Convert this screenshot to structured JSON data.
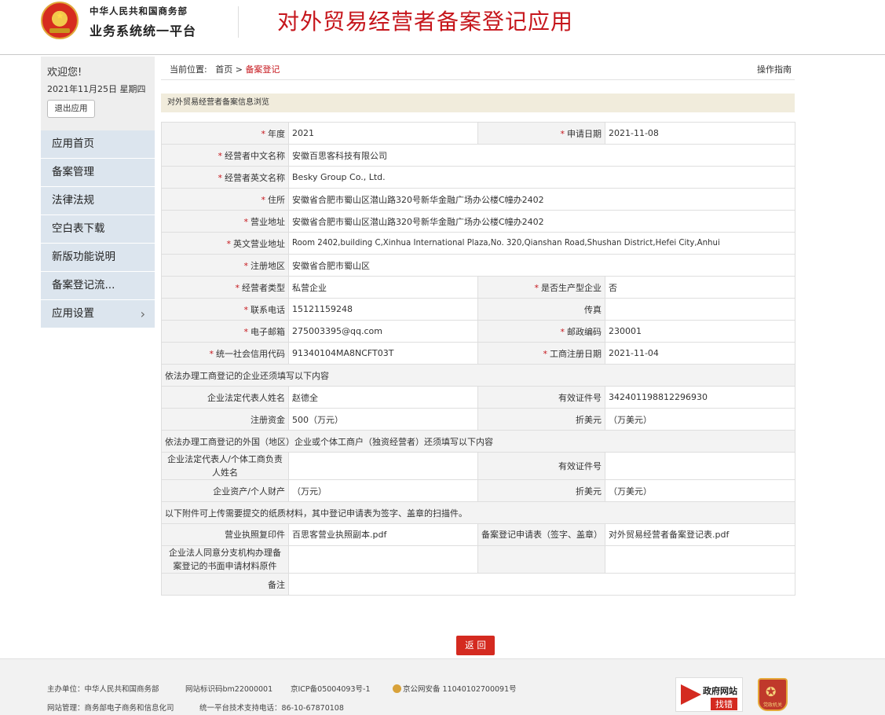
{
  "header": {
    "org_line1": "中华人民共和国商务部",
    "org_line2": "业务系统统一平台",
    "app_title": "对外贸易经营者备案登记应用"
  },
  "sidebar": {
    "welcome": "欢迎您!",
    "date": "2021年11月25日 星期四",
    "logout_label": "退出应用",
    "items": [
      {
        "label": "应用首页"
      },
      {
        "label": "备案管理"
      },
      {
        "label": "法律法规"
      },
      {
        "label": "空白表下载"
      },
      {
        "label": "新版功能说明"
      },
      {
        "label": "备案登记流..."
      },
      {
        "label": "应用设置",
        "icon": "chevron-right-icon"
      }
    ]
  },
  "breadcrumb": {
    "prefix": "当前位置:",
    "home": "首页",
    "sep": ">",
    "current": "备案登记"
  },
  "guide_link": "操作指南",
  "section_title": "对外贸易经营者备案信息浏览",
  "form": {
    "year_label": "年度",
    "year": "2021",
    "apply_date_label": "申请日期",
    "apply_date": "2021-11-08",
    "cn_name_label": "经营者中文名称",
    "cn_name": "安徽百思客科技有限公司",
    "en_name_label": "经营者英文名称",
    "en_name": "Besky Group Co., Ltd.",
    "residence_label": "住所",
    "residence": "安徽省合肥市蜀山区潜山路320号新华金融广场办公楼C幢办2402",
    "biz_addr_label": "营业地址",
    "biz_addr": "安徽省合肥市蜀山区潜山路320号新华金融广场办公楼C幢办2402",
    "en_biz_addr_label": "英文营业地址",
    "en_biz_addr": "Room 2402,building C,Xinhua International Plaza,No. 320,Qianshan Road,Shushan District,Hefei City,Anhui",
    "reg_area_label": "注册地区",
    "reg_area": "安徽省合肥市蜀山区",
    "type_label": "经营者类型",
    "type": "私营企业",
    "producer_label": "是否生产型企业",
    "producer": "否",
    "phone_label": "联系电话",
    "phone": "15121159248",
    "fax_label": "传真",
    "fax": "",
    "email_label": "电子邮箱",
    "email": "275003395@qq.com",
    "postcode_label": "邮政编码",
    "postcode": "230001",
    "credit_code_label": "统一社会信用代码",
    "credit_code": "91340104MA8NCFT03T",
    "biz_reg_date_label": "工商注册日期",
    "biz_reg_date": "2021-11-04",
    "sec1": "依法办理工商登记的企业还须填写以下内容",
    "legal_rep_label": "企业法定代表人姓名",
    "legal_rep": "赵德全",
    "id_no_label": "有效证件号",
    "id_no": "342401198812296930",
    "capital_label": "注册资金",
    "capital": "500（万元）",
    "usd_label": "折美元",
    "usd": "（万美元）",
    "sec2": "依法办理工商登记的外国（地区）企业或个体工商户（独资经营者）还须填写以下内容",
    "foreign_rep_label": "企业法定代表人/个体工商负责人姓名",
    "foreign_rep": "",
    "foreign_id_label": "有效证件号",
    "foreign_id": "",
    "assets_label": "企业资产/个人财产",
    "assets": "（万元）",
    "usd2_label": "折美元",
    "usd2": "（万美元）",
    "sec3": "以下附件可上传需要提交的纸质材料，其中登记申请表为签字、盖章的扫描件。",
    "license_copy_label": "营业执照复印件",
    "license_copy": "百思客营业执照副本.pdf",
    "reg_form_label": "备案登记申请表（签字、盖章）",
    "reg_form": "对外贸易经营者备案登记表.pdf",
    "branch_label": "企业法人同意分支机构办理备案登记的书面申请材料原件",
    "branch": "",
    "remark_label": "备注",
    "remark": ""
  },
  "back_label": "返 回",
  "footer": {
    "sponsor": "主办单位：中华人民共和国商务部",
    "site_id": "网站标识码bm22000001",
    "icp": "京ICP备05004093号-1",
    "police": "京公网安备 11040102700091号",
    "manager": "网站管理：商务部电子商务和信息化司",
    "support": "统一平台技术支持电话：86-10-67870108",
    "gov_badge_t1": "政府网站",
    "gov_badge_t2": "找错",
    "party_badge": "党政机关"
  }
}
